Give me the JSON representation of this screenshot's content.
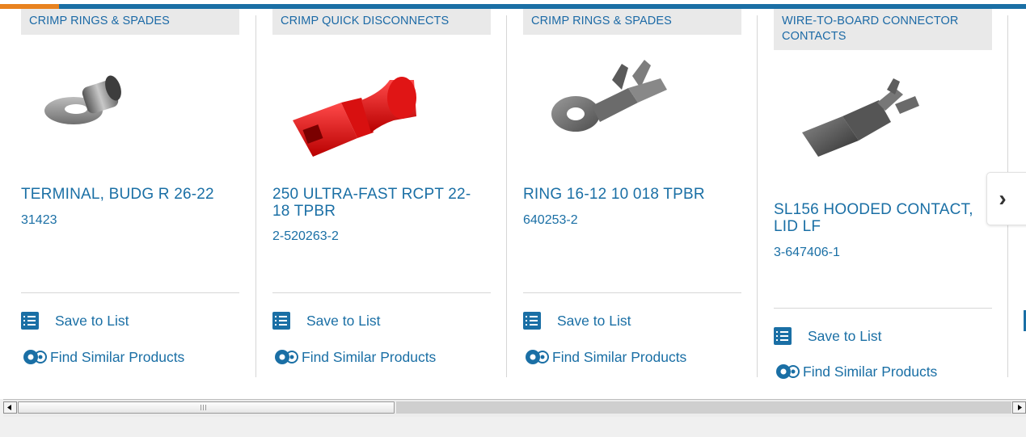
{
  "products": [
    {
      "category": "CRIMP RINGS & SPADES",
      "title": "TERMINAL, BUDG R 26-22",
      "part_number": "31423",
      "save_label": "Save to List",
      "similar_label": "Find Similar Products"
    },
    {
      "category": "CRIMP QUICK DISCONNECTS",
      "title": "250 ULTRA-FAST RCPT 22-18 TPBR",
      "part_number": "2-520263-2",
      "save_label": "Save to List",
      "similar_label": "Find Similar Products"
    },
    {
      "category": "CRIMP RINGS & SPADES",
      "title": "RING 16-12 10 018 TPBR",
      "part_number": "640253-2",
      "save_label": "Save to List",
      "similar_label": "Find Similar Products"
    },
    {
      "category": "WIRE-TO-BOARD CONNECTOR CONTACTS",
      "title": "SL156 HOODED CONTACT, LID LF",
      "part_number": "3-647406-1",
      "save_label": "Save to List",
      "similar_label": "Find Similar Products"
    }
  ],
  "carousel": {
    "next_icon": "chevron-right-icon"
  },
  "colors": {
    "accent": "#1a6fa5",
    "brand_orange": "#e8821f",
    "category_bg": "#e9e9e9"
  }
}
